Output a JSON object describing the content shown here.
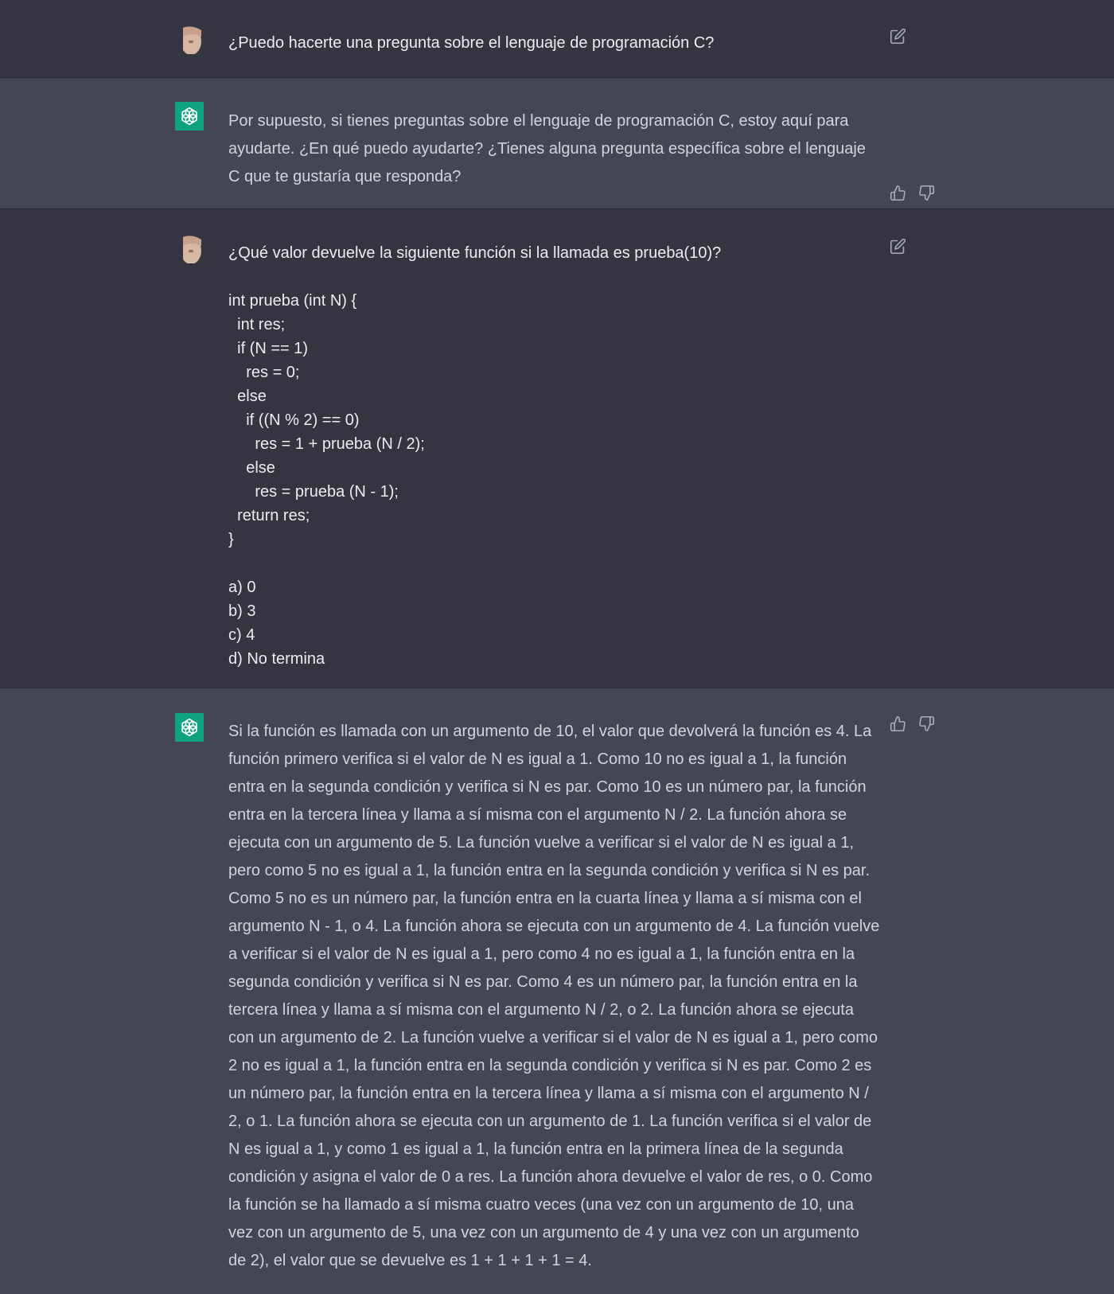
{
  "conversation": [
    {
      "role": "user",
      "text": "¿Puedo hacerte una pregunta sobre el lenguaje de programación C?",
      "actions": [
        "edit-icon"
      ]
    },
    {
      "role": "assistant",
      "text": "Por supuesto, si tienes preguntas sobre el lenguaje de programación C, estoy aquí para ayudarte. ¿En qué puedo ayudarte? ¿Tienes alguna pregunta específica sobre el lenguaje C que te gustaría que responda?",
      "actions": [
        "thumbs-up-icon",
        "thumbs-down-icon"
      ]
    },
    {
      "role": "user",
      "text": "¿Qué valor devuelve la siguiente función si la llamada es prueba(10)?\n\nint prueba (int N) {\n  int res;\n  if (N == 1)\n    res = 0;\n  else\n    if ((N % 2) == 0)\n      res = 1 + prueba (N / 2);\n    else\n      res = prueba (N - 1);\n  return res;\n}\n\na) 0\nb) 3\nc) 4\nd) No termina",
      "actions": [
        "edit-icon"
      ]
    },
    {
      "role": "assistant",
      "text": "Si la función es llamada con un argumento de 10, el valor que devolverá la función es 4. La función primero verifica si el valor de N es igual a 1. Como 10 no es igual a 1, la función entra en la segunda condición y verifica si N es par. Como 10 es un número par, la función entra en la tercera línea y llama a sí misma con el argumento N / 2. La función ahora se ejecuta con un argumento de 5. La función vuelve a verificar si el valor de N es igual a 1, pero como 5 no es igual a 1, la función entra en la segunda condición y verifica si N es par. Como 5 no es un número par, la función entra en la cuarta línea y llama a sí misma con el argumento N - 1, o 4. La función ahora se ejecuta con un argumento de 4. La función vuelve a verificar si el valor de N es igual a 1, pero como 4 no es igual a 1, la función entra en la segunda condición y verifica si N es par. Como 4 es un número par, la función entra en la tercera línea y llama a sí misma con el argumento N / 2, o 2. La función ahora se ejecuta con un argumento de 2. La función vuelve a verificar si el valor de N es igual a 1, pero como 2 no es igual a 1, la función entra en la segunda condición y verifica si N es par. Como 2 es un número par, la función entra en la tercera línea y llama a sí misma con el argumento N / 2, o 1. La función ahora se ejecuta con un argumento de 1. La función verifica si el valor de N es igual a 1, y como 1 es igual a 1, la función entra en la primera línea de la segunda condición y asigna el valor de 0 a res. La función ahora devuelve el valor de res, o 0. Como la función se ha llamado a sí misma cuatro veces (una vez con un argumento de 10, una vez con un argumento de 5, una vez con un argumento de 4 y una vez con un argumento de 2), el valor que se devuelve es 1 + 1 + 1 + 1 = 4.",
      "actions": [
        "thumbs-up-icon",
        "thumbs-down-icon"
      ]
    }
  ],
  "colors": {
    "user_bg": "#343541",
    "assistant_bg": "#444654",
    "assistant_avatar": "#10a37f",
    "icon": "#acacbe"
  }
}
